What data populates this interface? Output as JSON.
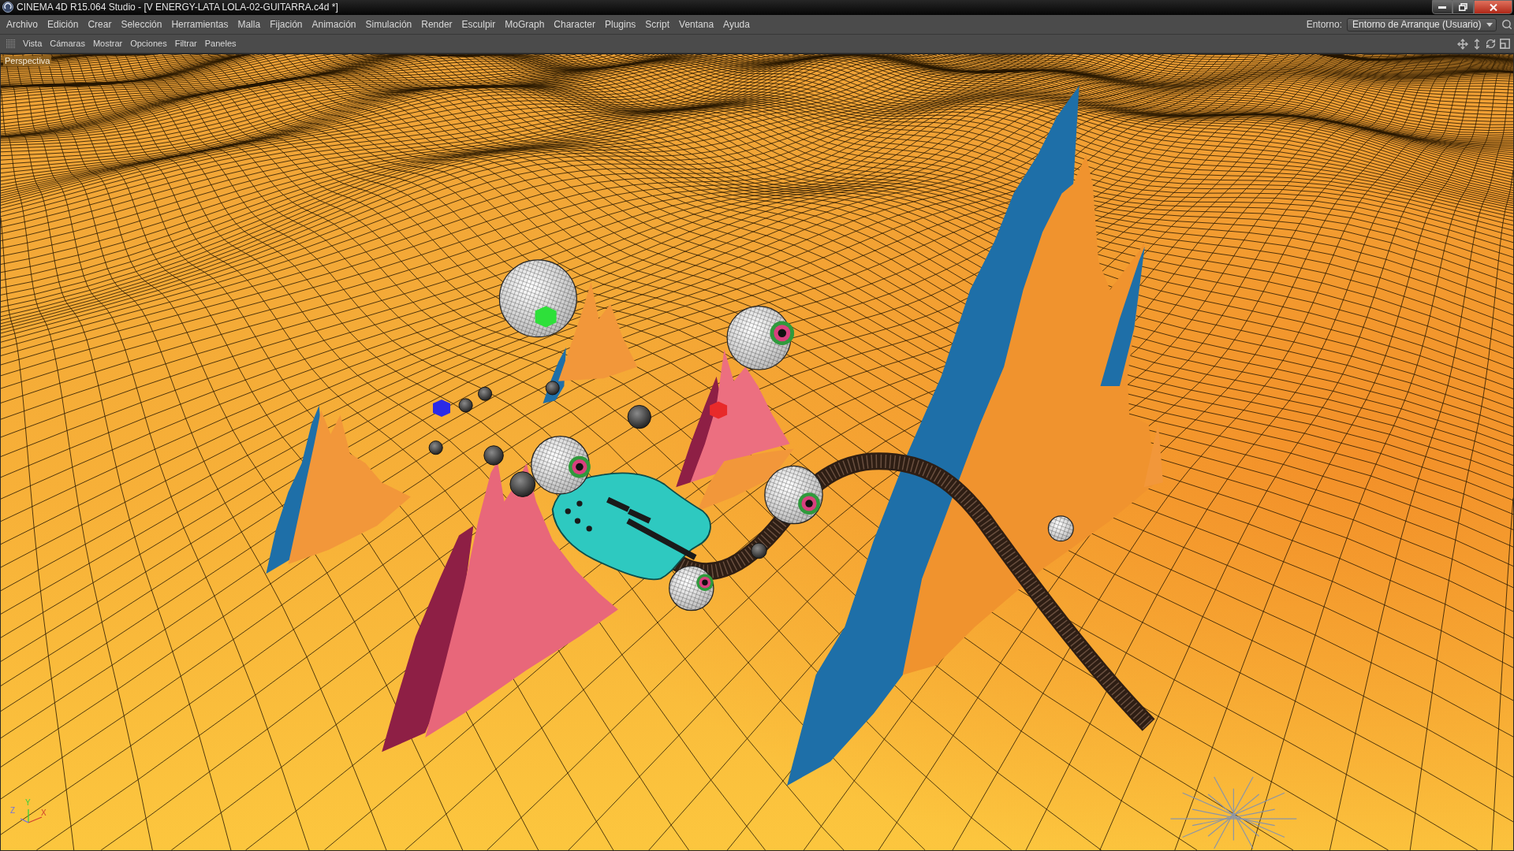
{
  "window": {
    "title": "CINEMA 4D R15.064 Studio - [V ENERGY-LATA LOLA-02-GUITARRA.c4d *]"
  },
  "menu_bar": {
    "items": [
      "Archivo",
      "Edición",
      "Crear",
      "Selección",
      "Herramientas",
      "Malla",
      "Fijación",
      "Animación",
      "Simulación",
      "Render",
      "Esculpir",
      "MoGraph",
      "Character",
      "Plugins",
      "Script",
      "Ventana",
      "Ayuda"
    ],
    "environment": {
      "label": "Entorno:",
      "value": "Entorno de Arranque (Usuario)"
    }
  },
  "viewport_menu": {
    "items": [
      "Vista",
      "Cámaras",
      "Mostrar",
      "Opciones",
      "Filtrar",
      "Paneles"
    ]
  },
  "viewport": {
    "label": "Perspectiva",
    "axes": {
      "x": "X",
      "y": "Y",
      "z": "Z"
    }
  }
}
